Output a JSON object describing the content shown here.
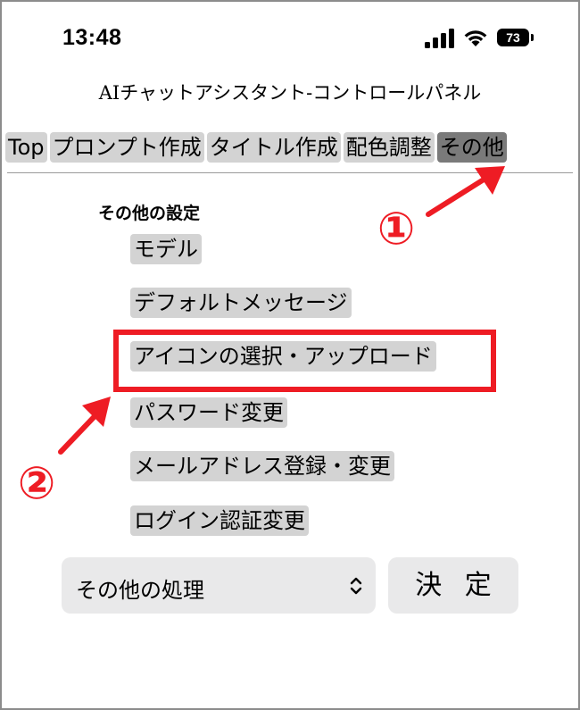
{
  "status_bar": {
    "time": "13:48",
    "battery": "73"
  },
  "app": {
    "title": "AIチャットアシスタント-コントロールパネル"
  },
  "tabs": [
    {
      "label": "Top",
      "active": false
    },
    {
      "label": "プロンプト作成",
      "active": false
    },
    {
      "label": "タイトル作成",
      "active": false
    },
    {
      "label": "配色調整",
      "active": false
    },
    {
      "label": "その他",
      "active": true
    }
  ],
  "settings": {
    "heading": "その他の設定",
    "items": [
      {
        "label": "モデル"
      },
      {
        "label": "デフォルトメッセージ"
      },
      {
        "label": "アイコンの選択・アップロード"
      },
      {
        "label": "パスワード変更"
      },
      {
        "label": "メールアドレス登録・変更"
      },
      {
        "label": "ログイン認証変更"
      }
    ]
  },
  "action_bar": {
    "select_value": "その他の処理",
    "submit_label": "決 定"
  },
  "annotations": {
    "marker_1": "①",
    "marker_2": "②",
    "color": "#ee1c24"
  },
  "colors": {
    "tab_bg": "#d3d3d3",
    "tab_active_bg": "#7a7a7a",
    "control_bg": "#e9e9ea"
  }
}
